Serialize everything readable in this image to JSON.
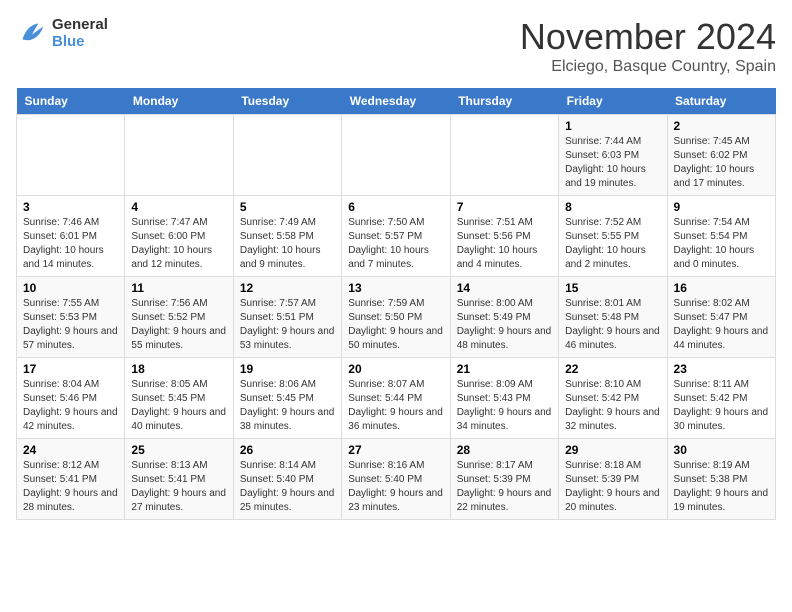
{
  "logo": {
    "line1": "General",
    "line2": "Blue"
  },
  "title": "November 2024",
  "location": "Elciego, Basque Country, Spain",
  "weekdays": [
    "Sunday",
    "Monday",
    "Tuesday",
    "Wednesday",
    "Thursday",
    "Friday",
    "Saturday"
  ],
  "weeks": [
    [
      {
        "day": "",
        "content": ""
      },
      {
        "day": "",
        "content": ""
      },
      {
        "day": "",
        "content": ""
      },
      {
        "day": "",
        "content": ""
      },
      {
        "day": "",
        "content": ""
      },
      {
        "day": "1",
        "content": "Sunrise: 7:44 AM\nSunset: 6:03 PM\nDaylight: 10 hours and 19 minutes."
      },
      {
        "day": "2",
        "content": "Sunrise: 7:45 AM\nSunset: 6:02 PM\nDaylight: 10 hours and 17 minutes."
      }
    ],
    [
      {
        "day": "3",
        "content": "Sunrise: 7:46 AM\nSunset: 6:01 PM\nDaylight: 10 hours and 14 minutes."
      },
      {
        "day": "4",
        "content": "Sunrise: 7:47 AM\nSunset: 6:00 PM\nDaylight: 10 hours and 12 minutes."
      },
      {
        "day": "5",
        "content": "Sunrise: 7:49 AM\nSunset: 5:58 PM\nDaylight: 10 hours and 9 minutes."
      },
      {
        "day": "6",
        "content": "Sunrise: 7:50 AM\nSunset: 5:57 PM\nDaylight: 10 hours and 7 minutes."
      },
      {
        "day": "7",
        "content": "Sunrise: 7:51 AM\nSunset: 5:56 PM\nDaylight: 10 hours and 4 minutes."
      },
      {
        "day": "8",
        "content": "Sunrise: 7:52 AM\nSunset: 5:55 PM\nDaylight: 10 hours and 2 minutes."
      },
      {
        "day": "9",
        "content": "Sunrise: 7:54 AM\nSunset: 5:54 PM\nDaylight: 10 hours and 0 minutes."
      }
    ],
    [
      {
        "day": "10",
        "content": "Sunrise: 7:55 AM\nSunset: 5:53 PM\nDaylight: 9 hours and 57 minutes."
      },
      {
        "day": "11",
        "content": "Sunrise: 7:56 AM\nSunset: 5:52 PM\nDaylight: 9 hours and 55 minutes."
      },
      {
        "day": "12",
        "content": "Sunrise: 7:57 AM\nSunset: 5:51 PM\nDaylight: 9 hours and 53 minutes."
      },
      {
        "day": "13",
        "content": "Sunrise: 7:59 AM\nSunset: 5:50 PM\nDaylight: 9 hours and 50 minutes."
      },
      {
        "day": "14",
        "content": "Sunrise: 8:00 AM\nSunset: 5:49 PM\nDaylight: 9 hours and 48 minutes."
      },
      {
        "day": "15",
        "content": "Sunrise: 8:01 AM\nSunset: 5:48 PM\nDaylight: 9 hours and 46 minutes."
      },
      {
        "day": "16",
        "content": "Sunrise: 8:02 AM\nSunset: 5:47 PM\nDaylight: 9 hours and 44 minutes."
      }
    ],
    [
      {
        "day": "17",
        "content": "Sunrise: 8:04 AM\nSunset: 5:46 PM\nDaylight: 9 hours and 42 minutes."
      },
      {
        "day": "18",
        "content": "Sunrise: 8:05 AM\nSunset: 5:45 PM\nDaylight: 9 hours and 40 minutes."
      },
      {
        "day": "19",
        "content": "Sunrise: 8:06 AM\nSunset: 5:45 PM\nDaylight: 9 hours and 38 minutes."
      },
      {
        "day": "20",
        "content": "Sunrise: 8:07 AM\nSunset: 5:44 PM\nDaylight: 9 hours and 36 minutes."
      },
      {
        "day": "21",
        "content": "Sunrise: 8:09 AM\nSunset: 5:43 PM\nDaylight: 9 hours and 34 minutes."
      },
      {
        "day": "22",
        "content": "Sunrise: 8:10 AM\nSunset: 5:42 PM\nDaylight: 9 hours and 32 minutes."
      },
      {
        "day": "23",
        "content": "Sunrise: 8:11 AM\nSunset: 5:42 PM\nDaylight: 9 hours and 30 minutes."
      }
    ],
    [
      {
        "day": "24",
        "content": "Sunrise: 8:12 AM\nSunset: 5:41 PM\nDaylight: 9 hours and 28 minutes."
      },
      {
        "day": "25",
        "content": "Sunrise: 8:13 AM\nSunset: 5:41 PM\nDaylight: 9 hours and 27 minutes."
      },
      {
        "day": "26",
        "content": "Sunrise: 8:14 AM\nSunset: 5:40 PM\nDaylight: 9 hours and 25 minutes."
      },
      {
        "day": "27",
        "content": "Sunrise: 8:16 AM\nSunset: 5:40 PM\nDaylight: 9 hours and 23 minutes."
      },
      {
        "day": "28",
        "content": "Sunrise: 8:17 AM\nSunset: 5:39 PM\nDaylight: 9 hours and 22 minutes."
      },
      {
        "day": "29",
        "content": "Sunrise: 8:18 AM\nSunset: 5:39 PM\nDaylight: 9 hours and 20 minutes."
      },
      {
        "day": "30",
        "content": "Sunrise: 8:19 AM\nSunset: 5:38 PM\nDaylight: 9 hours and 19 minutes."
      }
    ]
  ]
}
